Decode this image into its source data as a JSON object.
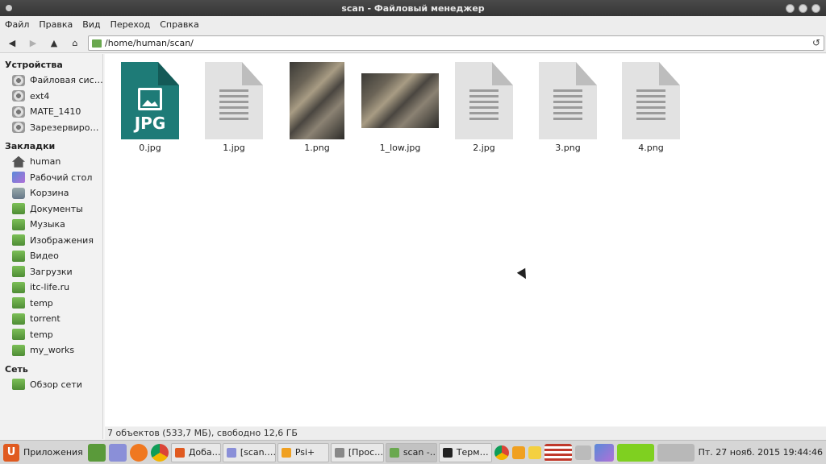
{
  "window": {
    "title": "scan - Файловый менеджер"
  },
  "menu": [
    "Файл",
    "Правка",
    "Вид",
    "Переход",
    "Справка"
  ],
  "toolbar": {
    "back_icon": "arrow-left-icon",
    "forward_icon": "arrow-right-icon",
    "up_icon": "arrow-up-icon",
    "home_icon": "home-icon",
    "address": "/home/human/scan/",
    "reload_icon": "reload-icon"
  },
  "sidebar": {
    "devices_title": "Устройства",
    "devices": [
      {
        "label": "Файловая сис…",
        "icon": "disk-icon"
      },
      {
        "label": "ext4",
        "icon": "disk-icon"
      },
      {
        "label": "MATE_1410",
        "icon": "disk-icon"
      },
      {
        "label": "Зарезервиро…",
        "icon": "disk-icon"
      }
    ],
    "bookmarks_title": "Закладки",
    "bookmarks": [
      {
        "label": "human",
        "icon": "home-icon"
      },
      {
        "label": "Рабочий стол",
        "icon": "desktop-icon"
      },
      {
        "label": "Корзина",
        "icon": "trash-icon"
      },
      {
        "label": "Документы",
        "icon": "folder-icon"
      },
      {
        "label": "Музыка",
        "icon": "folder-icon"
      },
      {
        "label": "Изображения",
        "icon": "folder-icon"
      },
      {
        "label": "Видео",
        "icon": "folder-icon"
      },
      {
        "label": "Загрузки",
        "icon": "folder-icon"
      },
      {
        "label": "itc-life.ru",
        "icon": "folder-icon"
      },
      {
        "label": "temp",
        "icon": "folder-icon"
      },
      {
        "label": "torrent",
        "icon": "folder-icon"
      },
      {
        "label": "temp",
        "icon": "folder-icon"
      },
      {
        "label": "my_works",
        "icon": "folder-icon"
      }
    ],
    "network_title": "Сеть",
    "network": [
      {
        "label": "Обзор сети",
        "icon": "network-icon"
      }
    ]
  },
  "files": [
    {
      "name": "0.jpg",
      "type": "jpg-icon",
      "badge": "JPG"
    },
    {
      "name": "1.jpg",
      "type": "document-icon"
    },
    {
      "name": "1.png",
      "type": "photo-thumbnail"
    },
    {
      "name": "1_low.jpg",
      "type": "photo-thumbnail"
    },
    {
      "name": "2.jpg",
      "type": "document-icon"
    },
    {
      "name": "3.png",
      "type": "document-icon"
    },
    {
      "name": "4.png",
      "type": "document-icon"
    }
  ],
  "status": "7 объектов (533,7 МБ), свободно 12,6 ГБ",
  "taskbar": {
    "apps_label": "Приложения",
    "tasks": [
      {
        "label": "Доба…",
        "icon": "ubuntu-icon"
      },
      {
        "label": "[scan.…",
        "icon": "text-editor-icon"
      },
      {
        "label": "Psi+",
        "icon": "star-icon"
      },
      {
        "label": "[Прос…",
        "icon": "viewer-icon"
      },
      {
        "label": "scan -…",
        "icon": "folder-icon",
        "active": true
      },
      {
        "label": "Терм…",
        "icon": "terminal-icon"
      }
    ],
    "clock": "Пт. 27 нояб. 2015 19:44:46"
  }
}
